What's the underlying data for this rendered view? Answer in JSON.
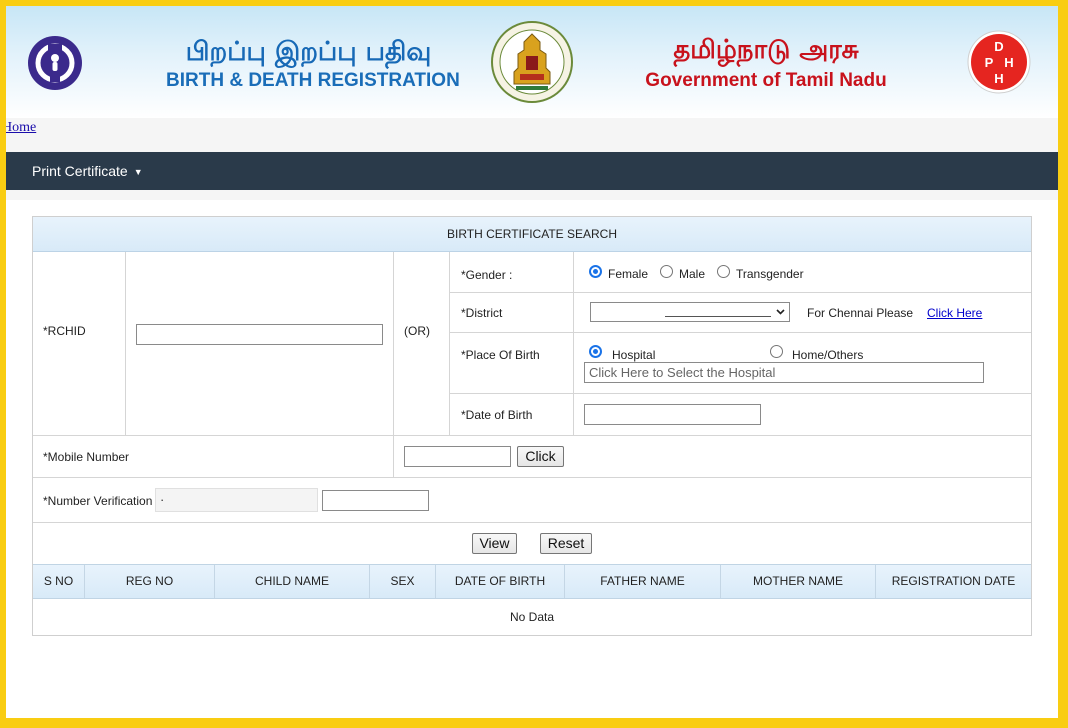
{
  "header": {
    "tamil_title": "பிறப்பு இறப்பு பதிவு",
    "english_title": "BIRTH & DEATH REGISTRATION",
    "govt_tamil": "தமிழ்நாடு அரசு",
    "govt_english": "Government of Tamil Nadu",
    "dph_letters": [
      "D",
      "P",
      "H",
      "H"
    ]
  },
  "breadcrumb": {
    "home": "Home"
  },
  "nav": {
    "print_certificate": "Print Certificate",
    "caret": "▼"
  },
  "form": {
    "title": "BIRTH CERTIFICATE SEARCH",
    "rchid_label": "*RCHID",
    "or_label": "(OR)",
    "gender_label": "*Gender :",
    "gender_options": [
      "Female",
      "Male",
      "Transgender"
    ],
    "gender_selected": "Female",
    "district_label": "*District",
    "district_value": "",
    "chennai_text": "For Chennai Please",
    "chennai_link": "Click Here",
    "place_label": "*Place Of Birth",
    "place_options": [
      "Hospital",
      "Home/Others"
    ],
    "place_selected": "Hospital",
    "hospital_placeholder": "Click Here to Select the Hospital",
    "dob_label": "*Date of Birth",
    "mobile_label": "*Mobile Number",
    "click_button": "Click",
    "verification_label": "*Number Verification",
    "verification_code": "·",
    "view_button": "View",
    "reset_button": "Reset"
  },
  "results": {
    "columns": [
      "S NO",
      "REG NO",
      "CHILD NAME",
      "SEX",
      "DATE OF BIRTH",
      "FATHER NAME",
      "MOTHER NAME",
      "REGISTRATION DATE"
    ],
    "empty_text": "No Data"
  },
  "colors": {
    "frame": "#f9cd12",
    "navbar": "#2a3a4a",
    "title_blue": "#1769b6",
    "govt_red": "#c8121c",
    "radio_blue": "#1a73e8"
  }
}
